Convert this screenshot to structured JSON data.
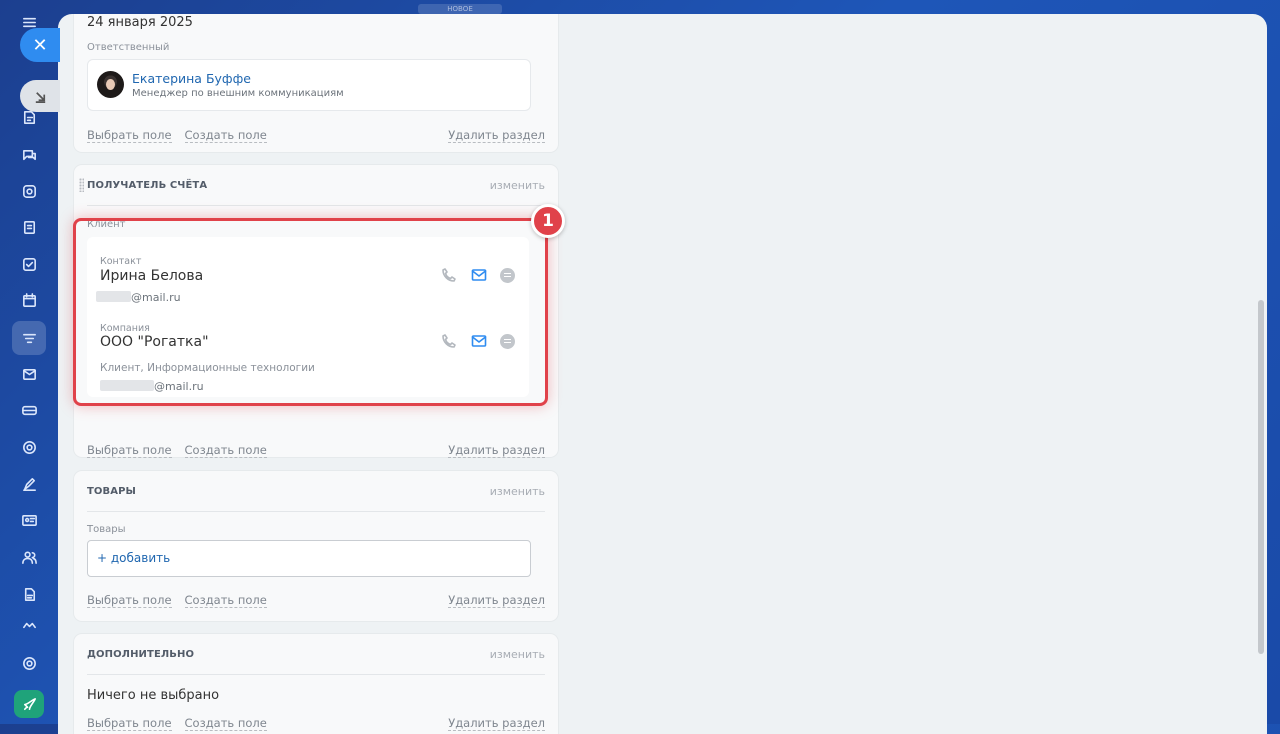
{
  "top_hint": "НОВОЕ",
  "rail": {
    "icons": [
      "menu-icon",
      "tasks-edit-icon",
      "chat-icon",
      "feed-icon",
      "documents-icon",
      "checkbox-icon",
      "calendar-icon",
      "crm-funnel-icon",
      "mail-icon",
      "terminal-icon",
      "target-icon",
      "sign-icon",
      "contact-card-icon",
      "users-icon",
      "file-icon",
      "bot-icon",
      "settings-icon",
      "rocket-icon"
    ]
  },
  "section_main": {
    "date": "24 января 2025",
    "responsible_label": "Ответственный",
    "responsible": {
      "name": "Екатерина Буффе",
      "position": "Менеджер по внешним коммуникациям"
    },
    "footer": {
      "select_field": "Выбрать поле",
      "create_field": "Создать поле",
      "delete_section": "Удалить раздел"
    }
  },
  "section_recipient": {
    "title": "ПОЛУЧАТЕЛЬ СЧЁТА",
    "edit": "изменить",
    "client_label": "Клиент",
    "contact": {
      "label": "Контакт",
      "name": "Ирина Белова",
      "email_suffix": "@mail.ru"
    },
    "company": {
      "label": "Компания",
      "name": "ООО \"Рогатка\"",
      "details": "Клиент, Информационные технологии",
      "email_suffix": "@mail.ru"
    },
    "footer": {
      "select_field": "Выбрать поле",
      "create_field": "Создать поле",
      "delete_section": "Удалить раздел"
    },
    "badge": "1"
  },
  "section_products": {
    "title": "ТОВАРЫ",
    "edit": "изменить",
    "field_label": "Товары",
    "add": "+ добавить",
    "footer": {
      "select_field": "Выбрать поле",
      "create_field": "Создать поле",
      "delete_section": "Удалить раздел"
    }
  },
  "section_additional": {
    "title": "ДОПОЛНИТЕЛЬНО",
    "edit": "изменить",
    "nothing": "Ничего не выбрано",
    "footer": {
      "select_field": "Выбрать поле",
      "create_field": "Создать поле",
      "delete_section": "Удалить раздел"
    }
  },
  "colors": {
    "accent": "#2f8cf0",
    "highlight": "#e0424a",
    "link": "#2067b0"
  }
}
